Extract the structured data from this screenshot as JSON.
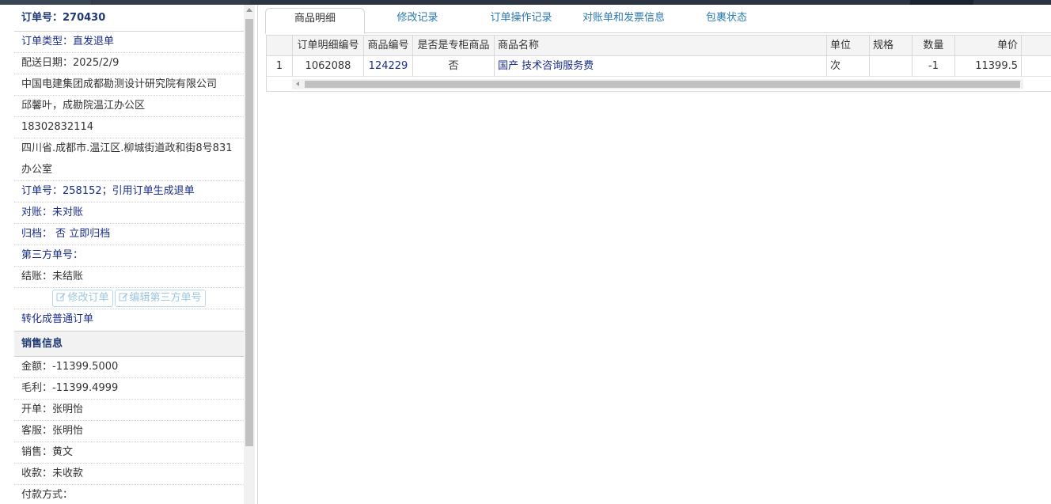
{
  "order_panel": {
    "title": "订单号：270430",
    "rows": [
      "订单类型：直发退单",
      "配送日期：2025/2/9",
      "中国电建集团成都勘测设计研究院有限公司",
      "邱馨叶，成勘院温江办公区",
      "18302832114",
      "四川省.成都市.温江区.柳城街道政和街8号831",
      "办公室",
      "订单号：258152；引用订单生成退单",
      "对账：未对账",
      "归档：  否 立即归档",
      "第三方单号：",
      "结账：未结账"
    ],
    "edit_order_button": "修改订单",
    "edit_third_party_button": "编辑第三方单号",
    "convert_link": "转化成普通订单"
  },
  "sales_panel": {
    "title": "销售信息",
    "rows": [
      "金额：-11399.5000",
      "毛利：-11399.4999",
      "开单：张明怡",
      "客服：张明怡",
      "销售：黄文",
      "收款：未收款",
      "付款方式："
    ]
  },
  "tabs": [
    "商品明细",
    "修改记录",
    "订单操作记录",
    "对账单和发票信息",
    "包裹状态"
  ],
  "grid": {
    "headers": [
      "订单明细编号",
      "商品编号",
      "是否是专柜商品",
      "商品名称",
      "单位",
      "规格",
      "数量",
      "单价"
    ],
    "rows": [
      {
        "index": "1",
        "detail_id": "1062088",
        "product_id": "124229",
        "is_counter": "否",
        "name": "国产 技术咨询服务费",
        "unit": "次",
        "spec": "",
        "qty": "-1",
        "price": "11399.5"
      }
    ]
  },
  "colors": {
    "accent_blue": "#1a2d8a",
    "tab_link": "#2a7ab0",
    "topbar": "#2b3440"
  }
}
